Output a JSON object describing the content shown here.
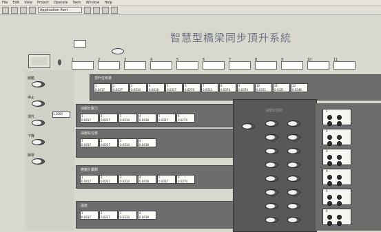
{
  "menu": [
    "File",
    "Edit",
    "View",
    "Project",
    "Operate",
    "Tools",
    "Window",
    "Help"
  ],
  "toolbar": {
    "font": "Application Font"
  },
  "title": "智慧型橋梁同步頂升系統",
  "top_left_label": "",
  "top_fields": [
    "1",
    "2",
    "3",
    "4",
    "5",
    "6",
    "7",
    "8",
    "9",
    "10",
    "11",
    "12"
  ],
  "big_panel": {
    "header": "頂升位移量",
    "cells": [
      {
        "n": "1",
        "v": "0.0417"
      },
      {
        "n": "2",
        "v": "0.0237"
      },
      {
        "n": "3",
        "v": "0.0310"
      },
      {
        "n": "4",
        "v": "0.0418"
      },
      {
        "n": "5",
        "v": "0.0337"
      },
      {
        "n": "6",
        "v": "0.0270"
      },
      {
        "n": "7",
        "v": "0.0313"
      },
      {
        "n": "8",
        "v": "0.0376"
      },
      {
        "n": "9",
        "v": "0.0376"
      },
      {
        "n": "10",
        "v": "0.0311"
      },
      {
        "n": "11",
        "v": "0.0321"
      },
      {
        "n": "12",
        "v": "0.0346"
      }
    ]
  },
  "panels": [
    {
      "header": "油壓缸壓力",
      "cells": [
        {
          "n": "1",
          "v": "0.0417"
        },
        {
          "n": "2",
          "v": "0.0237"
        },
        {
          "n": "3",
          "v": "0.0310"
        },
        {
          "n": "4",
          "v": "0.0418"
        },
        {
          "n": "5",
          "v": "0.0337"
        },
        {
          "n": "6",
          "v": "0.0270"
        }
      ]
    },
    {
      "header": "油壓缸位移",
      "cells": [
        {
          "n": "1",
          "v": "0.0417"
        },
        {
          "n": "2",
          "v": "0.0237"
        },
        {
          "n": "3",
          "v": "0.0310"
        },
        {
          "n": "4",
          "v": "0.0418"
        }
      ]
    },
    {
      "header": "應變計讀數",
      "cells": [
        {
          "n": "1",
          "v": "0.0417"
        },
        {
          "n": "2",
          "v": "0.0237"
        },
        {
          "n": "3",
          "v": "0.0310"
        },
        {
          "n": "4",
          "v": "0.0418"
        },
        {
          "n": "5",
          "v": "0.0337"
        },
        {
          "n": "6",
          "v": "0.0270"
        }
      ]
    },
    {
      "header": "溫度",
      "cells": [
        {
          "n": "1",
          "v": "0.0417"
        },
        {
          "n": "2",
          "v": "0.0237"
        },
        {
          "n": "3",
          "v": "0.0310"
        },
        {
          "n": "4",
          "v": "0.0418"
        }
      ]
    }
  ],
  "left_controls": [
    "啟動",
    "停止",
    "頂升",
    "下降",
    "歸零"
  ],
  "left_value": "1.2000",
  "mid_panel": {
    "header": "油壓缸控制"
  },
  "led_labels": [
    "1",
    "2",
    "3",
    "4",
    "5",
    "6",
    "7",
    "8",
    "9",
    "10",
    "11",
    "12"
  ]
}
